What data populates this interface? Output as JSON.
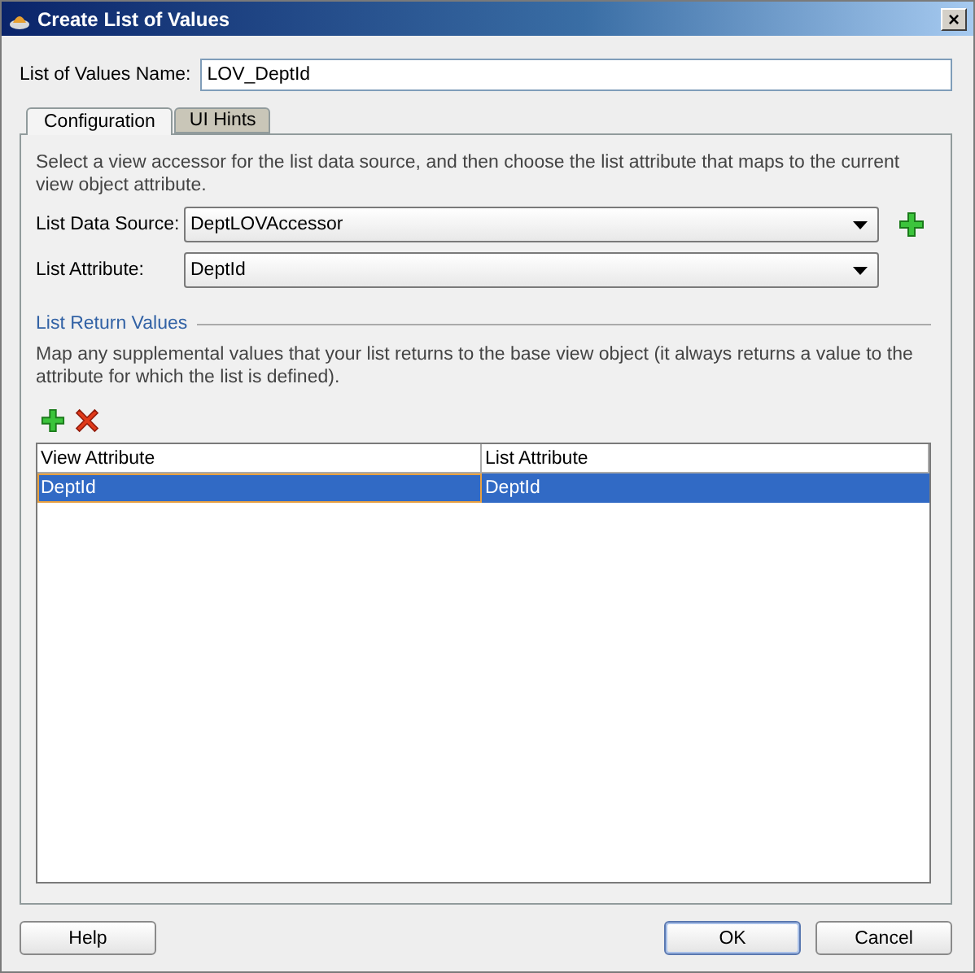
{
  "window": {
    "title": "Create List of Values",
    "close": "×"
  },
  "name_field": {
    "label": "List of Values Name:",
    "value": "LOV_DeptId"
  },
  "tabs": [
    {
      "label": "Configuration",
      "selected": true
    },
    {
      "label": "UI Hints",
      "selected": false
    }
  ],
  "description": "Select a view accessor for the list data source, and then choose the list attribute that maps to the current view object attribute.",
  "fields": [
    {
      "label": "List Data Source:",
      "value": "DeptLOVAccessor",
      "add_button": true
    },
    {
      "label": "List Attribute:",
      "value": "DeptId",
      "add_button": false
    }
  ],
  "return_values": {
    "title": "List Return Values",
    "description": "Map any supplemental values that your list returns to the base view object (it always returns a value to the attribute for which the list is defined).",
    "table": {
      "columns": [
        "View Attribute",
        "List Attribute"
      ],
      "rows": [
        {
          "cells": [
            "DeptId",
            "DeptId"
          ],
          "selected": true
        }
      ]
    }
  },
  "buttons": [
    {
      "label": "Help",
      "kind": "left",
      "default": false
    },
    {
      "label": "OK",
      "kind": "right",
      "default": true
    },
    {
      "label": "Cancel",
      "kind": "right",
      "default": false
    }
  ]
}
